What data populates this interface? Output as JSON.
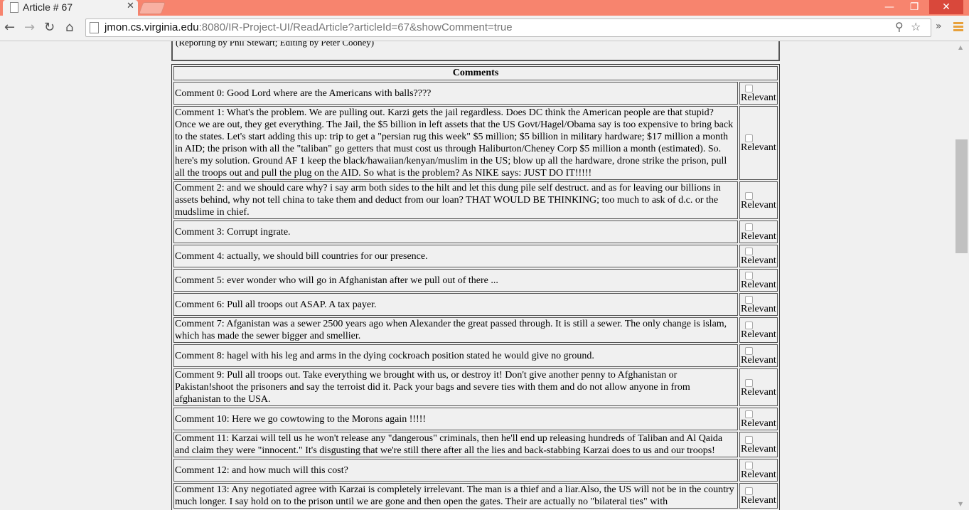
{
  "browser": {
    "tab_title": "Article # 67",
    "url_host": "jmon.cs.virginia.edu",
    "url_rest": ":8080/IR-Project-UI/ReadArticle?articleId=67&showComment=true",
    "win_minimize": "—",
    "win_restore": "❐",
    "win_close": "✕"
  },
  "article": {
    "prev_text": "(Reporting by Phil Stewart; Editing by Peter Cooney)"
  },
  "comments_header": "Comments",
  "relevant_label": "Relevant",
  "comments": [
    "Comment 0: Good Lord where are the Americans with balls????",
    "Comment 1: What's the problem. We are pulling out. Karzi gets the jail regardless. Does DC think the American people are that stupid? Once we are out, they get everything. The Jail, the $5 billion in left assets that the US Govt/Hagel/Obama say is too expensive to bring back to the states. Let's start adding this up: trip to get a \"persian rug this week\" $5 million; $5 billion in military hardware; $17 million a month in AID; the prison with all the \"taliban\" go getters that must cost us through Haliburton/Cheney Corp $5 million a month (estimated). So. here's my solution. Ground AF 1 keep the black/hawaiian/kenyan/muslim in the US; blow up all the hardware, drone strike the prison, pull all the troops out and pull the plug on the AID. So what is the problem? As NIKE says: JUST DO IT!!!!!",
    "Comment 2: and we should care why? i say arm both sides to the hilt and let this dung pile self destruct. and as for leaving our billions in assets behind, why not tell china to take them and deduct from our loan? THAT WOULD BE THINKING; too much to ask of d.c. or the mudslime in chief.",
    "Comment 3: Corrupt ingrate.",
    "Comment 4: actually, we should bill countries for our presence.",
    "Comment 5: ever wonder who will go in Afghanistan after we pull out of there ...",
    "Comment 6: Pull all troops out ASAP. A tax payer.",
    "Comment 7: Afganistan was a sewer 2500 years ago when Alexander the great passed through. It is still a sewer. The only change is islam, which has made the sewer bigger and smellier.",
    "Comment 8: hagel with his leg and arms in the dying cockroach position stated he would give no ground.",
    "Comment 9: Pull all troops out. Take everything we brought with us, or destroy it! Don't give another penny to Afghanistan or Pakistan!shoot the prisoners and say the terroist did it. Pack your bags and severe ties with them and do not allow anyone in from afghanistan to the USA.",
    "Comment 10: Here we go cowtowing to the Morons again !!!!!",
    "Comment 11: Karzai will tell us he won't release any \"dangerous\" criminals, then he'll end up releasing hundreds of Taliban and Al Qaida and claim they were \"innocent.\" It's disgusting that we're still there after all the lies and back-stabbing Karzai does to us and our troops!",
    "Comment 12: and how much will this cost?",
    "Comment 13: Any negotiated agree with Karzai is completely irrelevant. The man is a thief and a liar.Also, the US will not be in the country much longer. I say hold on to the prison until we are gone and then open the gates. Their are actually no \"bilateral ties\" with"
  ]
}
